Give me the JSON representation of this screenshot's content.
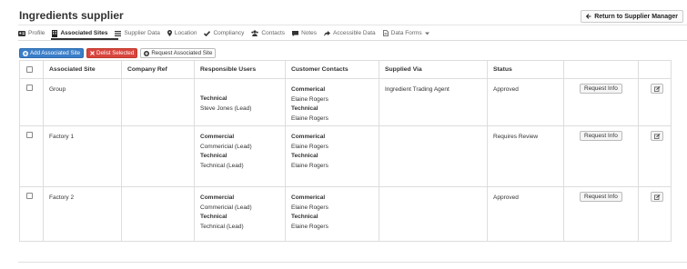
{
  "page": {
    "title": "Ingredients supplier",
    "return_label": "Return to Supplier Manager"
  },
  "tabs": [
    {
      "label": "Profile",
      "icon": "id-card-icon"
    },
    {
      "label": "Associated Sites",
      "icon": "building-icon"
    },
    {
      "label": "Supplier Data",
      "icon": "list-icon"
    },
    {
      "label": "Location",
      "icon": "map-marker-icon"
    },
    {
      "label": "Compliancy",
      "icon": "check-icon"
    },
    {
      "label": "Contacts",
      "icon": "users-icon"
    },
    {
      "label": "Notes",
      "icon": "comment-icon"
    },
    {
      "label": "Accessible Data",
      "icon": "share-icon"
    },
    {
      "label": "Data Forms",
      "icon": "file-icon"
    }
  ],
  "active_tab": "Associated Sites",
  "actions": {
    "add_label": "Add Associated Site",
    "delist_label": "Delist Selected",
    "request_label": "Request Associated Site"
  },
  "table": {
    "headers": [
      "Associated Site",
      "Company Ref",
      "Responsible Users",
      "Customer Contacts",
      "Supplied Via",
      "Status"
    ],
    "request_info_label": "Request Info",
    "rows": [
      {
        "site": "Group",
        "company_ref": "",
        "responsible": [
          "Technical",
          "Steve Jones (Lead)"
        ],
        "contacts": [
          "Commerical",
          "Elaine Rogers",
          "Technical",
          "Elaine Rogers"
        ],
        "supplied_via": "Ingredient Trading Agent",
        "status": "Approved"
      },
      {
        "site": "Factory 1",
        "company_ref": "",
        "responsible": [
          "Commercial",
          "Commericial (Lead)",
          "Technical",
          "Technical (Lead)"
        ],
        "contacts": [
          "Commerical",
          "Elaine Rogers",
          "Technical",
          "Elaine Rogers"
        ],
        "supplied_via": "",
        "status": "Requires Review"
      },
      {
        "site": "Factory 2",
        "company_ref": "",
        "responsible": [
          "Commercial",
          "Commericial (Lead)",
          "Technical",
          "Technical (Lead)"
        ],
        "contacts": [
          "Commerical",
          "Elaine Rogers",
          "Technical",
          "Elaine Rogers"
        ],
        "supplied_via": "",
        "status": "Approved"
      }
    ]
  },
  "colors": {
    "primary": "#3a7ec8",
    "danger": "#d8453e"
  }
}
